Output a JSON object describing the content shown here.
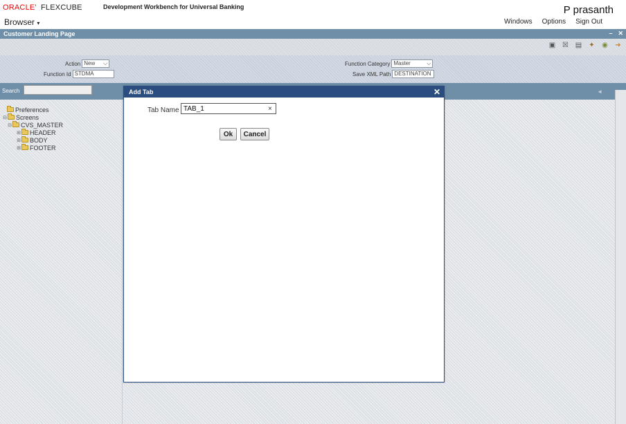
{
  "header": {
    "brand_oracle": "ORACLE'",
    "brand_product": "FLEXCUBE",
    "product_title": "Development Workbench for Universal Banking",
    "user": "P prasanth"
  },
  "menubar": {
    "browser_label": "Browser",
    "windows": "Windows",
    "options": "Options",
    "sign_out": "Sign Out"
  },
  "window": {
    "title": "Customer Landing Page"
  },
  "form": {
    "action_label": "Action",
    "action_value": "New",
    "function_id_label": "Function Id",
    "function_id_value": "STDMA",
    "function_category_label": "Function Category",
    "function_category_value": "Master",
    "save_xml_path_label": "Save XML Path",
    "save_xml_path_value": "DESTINATION"
  },
  "search": {
    "label": "Search",
    "value": ""
  },
  "tree": {
    "preferences": "Preferences",
    "screens": "Screens",
    "cvs_master": "CVS_MASTER",
    "header": "HEADER",
    "body": "BODY",
    "footer": "FOOTER"
  },
  "modal": {
    "title": "Add Tab",
    "tab_name_label": "Tab Name",
    "tab_name_value": "TAB_1",
    "ok_label": "Ok",
    "cancel_label": "Cancel"
  }
}
